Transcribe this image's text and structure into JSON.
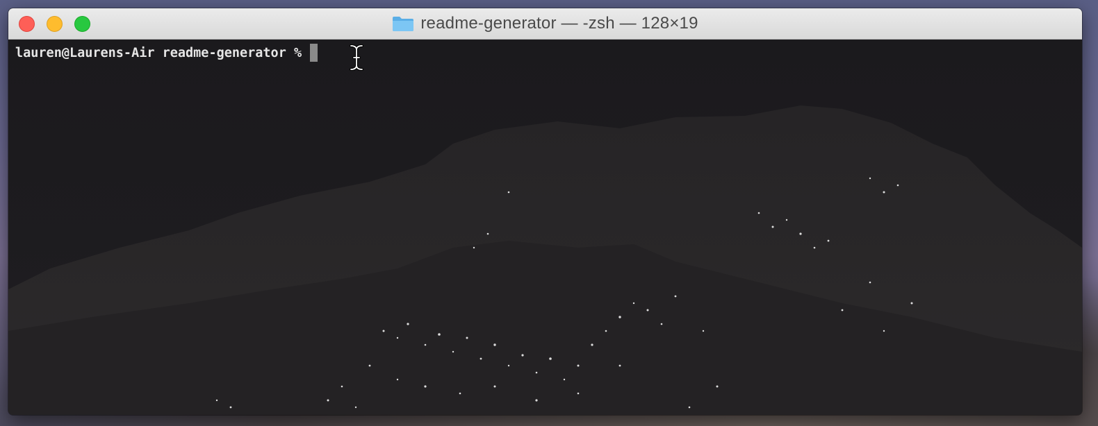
{
  "window": {
    "title": "readme-generator — -zsh — 128×19",
    "title_icon": "folder-icon",
    "controls": [
      "close-button",
      "minimize-button",
      "zoom-button"
    ]
  },
  "terminal": {
    "prompt": "lauren@Laurens-Air readme-generator %",
    "input": "",
    "cursor_icon": "text-cursor-icon"
  },
  "colors": {
    "close": "#fe5f57",
    "minimize": "#febc2e",
    "zoom": "#28c840",
    "terminal_bg": "#1c1b1e",
    "prompt_text": "#e6e6e6",
    "folder_icon": "#6cb9ef"
  }
}
